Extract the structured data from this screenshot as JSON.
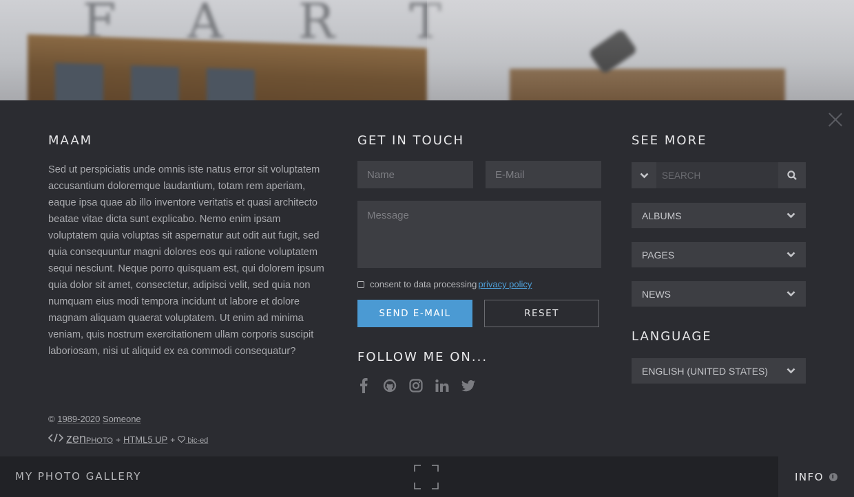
{
  "about": {
    "title": "MAAM",
    "text": "Sed ut perspiciatis unde omnis iste natus error sit voluptatem accusantium doloremque laudantium, totam rem aperiam, eaque ipsa quae ab illo inventore veritatis et quasi architecto beatae vitae dicta sunt explicabo. Nemo enim ipsam voluptatem quia voluptas sit aspernatur aut odit aut fugit, sed quia consequuntur magni dolores eos qui ratione voluptatem sequi nesciunt. Neque porro quisquam est, qui dolorem ipsum quia dolor sit amet, consectetur, adipisci velit, sed quia non numquam eius modi tempora incidunt ut labore et dolore magnam aliquam quaerat voluptatem. Ut enim ad minima veniam, quis nostrum exercitationem ullam corporis suscipit laboriosam, nisi ut aliquid ex ea commodi consequatur?",
    "copyright_symbol": "©",
    "copyright_years": "1989-2020",
    "copyright_owner": "Someone",
    "credits": {
      "zen": "zen",
      "photo": "PHOTO",
      "plus1": "+",
      "html5up": "HTML5 UP",
      "plus2": "+",
      "biced": "bic-ed"
    }
  },
  "contact": {
    "title": "GET IN TOUCH",
    "name_placeholder": "Name",
    "email_placeholder": "E-Mail",
    "message_placeholder": "Message",
    "consent_text": "consent to data processing",
    "privacy_link": " privacy policy",
    "send_label": "SEND E-MAIL",
    "reset_label": "RESET",
    "follow_title": "FOLLOW ME ON...",
    "social_icons": [
      "facebook-icon",
      "github-icon",
      "instagram-icon",
      "linkedin-icon",
      "twitter-icon"
    ]
  },
  "see_more": {
    "title": "SEE MORE",
    "search_placeholder": "SEARCH",
    "dropdowns": [
      "ALBUMS",
      "PAGES",
      "NEWS"
    ],
    "language_title": "LANGUAGE",
    "language_value": "ENGLISH (UNITED STATES)"
  },
  "bottom_bar": {
    "site_title": "MY PHOTO GALLERY",
    "info_label": "INFO",
    "info_icon": "i"
  },
  "colors": {
    "panel": "#2b2c31",
    "accent": "#4b9ad3",
    "link": "#4e9fd8"
  }
}
